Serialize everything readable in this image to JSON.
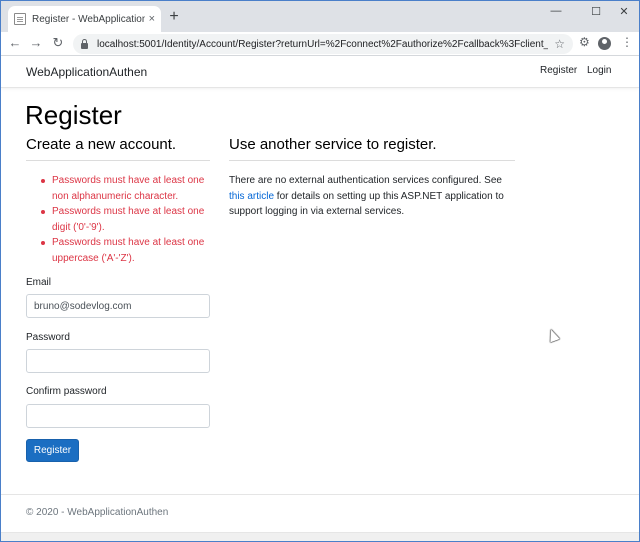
{
  "browser": {
    "tab_title": "Register - WebApplicationAuthen",
    "tab_close": "×",
    "new_tab": "+",
    "minimize": "—",
    "maximize": "☐",
    "close": "✕",
    "back": "←",
    "forward": "→",
    "reload": "↻",
    "url": "localhost:5001/Identity/Account/Register?returnUrl=%2Fconnect%2Fauthorize%2Fcallback%3Fclient_id%3DWebA...",
    "star": "☆",
    "extensions": "⚙",
    "menu": "⋮"
  },
  "navbar": {
    "brand": "WebApplicationAuthen",
    "register": "Register",
    "login": "Login"
  },
  "page": {
    "title": "Register",
    "left_heading": "Create a new account.",
    "right_heading": "Use another service to register.",
    "errors": [
      "Passwords must have at least one non alphanumeric character.",
      "Passwords must have at least one digit ('0'-'9').",
      "Passwords must have at least one uppercase ('A'-'Z')."
    ],
    "email_label": "Email",
    "email_value": "bruno@sodevlog.com",
    "password_label": "Password",
    "password_value": "",
    "confirm_label": "Confirm password",
    "confirm_value": "",
    "register_button": "Register",
    "external_text_1": "There are no external authentication services configured. See ",
    "external_link": "this article",
    "external_text_2": " for details on setting up this ASP.NET application to support logging in via external services."
  },
  "footer": {
    "text": "© 2020 - WebApplicationAuthen"
  },
  "colors": {
    "primary": "#1b6ec2",
    "error": "#dc3545",
    "link": "#0366d6"
  }
}
